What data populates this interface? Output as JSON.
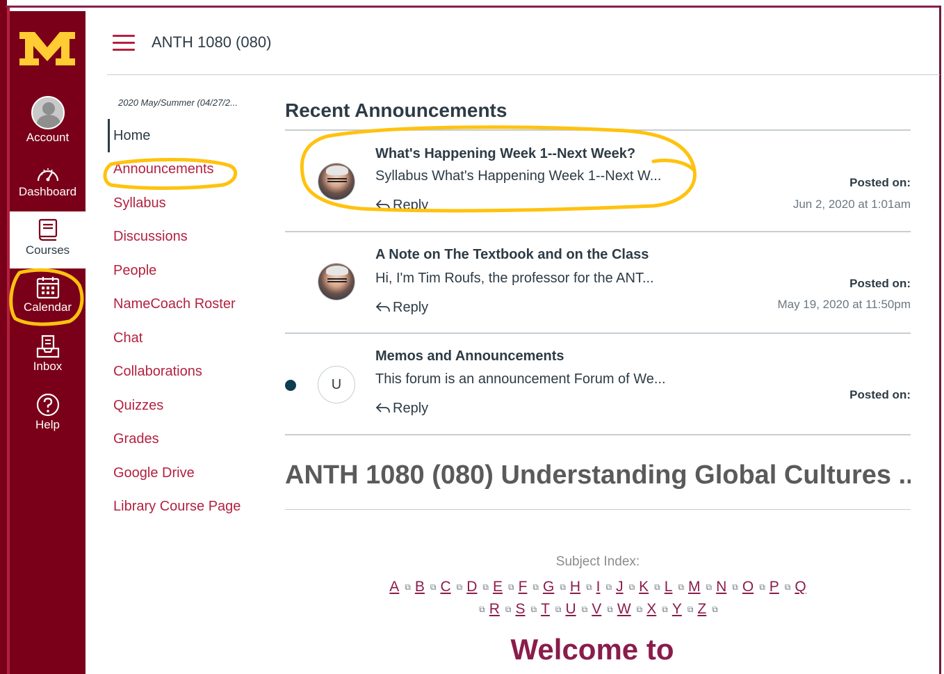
{
  "global_nav": {
    "items": [
      {
        "label": "Account",
        "icon": "account-avatar-icon"
      },
      {
        "label": "Dashboard",
        "icon": "dashboard-gauge-icon"
      },
      {
        "label": "Courses",
        "icon": "courses-book-icon"
      },
      {
        "label": "Calendar",
        "icon": "calendar-icon"
      },
      {
        "label": "Inbox",
        "icon": "inbox-icon"
      },
      {
        "label": "Help",
        "icon": "help-question-icon"
      }
    ],
    "active": "Courses",
    "colors": {
      "background": "#7a0019",
      "logo": "#ffcc33"
    }
  },
  "header": {
    "title": "ANTH 1080 (080)"
  },
  "course_nav": {
    "term": "2020 May/Summer (04/27/2...",
    "items": [
      "Home",
      "Announcements",
      "Syllabus",
      "Discussions",
      "People",
      "NameCoach Roster",
      "Chat",
      "Collaborations",
      "Quizzes",
      "Grades",
      "Google Drive",
      "Library Course Page"
    ],
    "active": "Home"
  },
  "announcements": {
    "section_title": "Recent Announcements",
    "items": [
      {
        "title": "What's Happening Week 1--Next Week?",
        "snippet": "Syllabus What's Happening Week 1--Next W...",
        "reply": "Reply",
        "posted_label": "Posted on:",
        "posted_date": "Jun 2, 2020 at 1:01am"
      },
      {
        "title": "A Note on The Textbook and on the Class",
        "snippet": "Hi,   I'm Tim Roufs, the professor for the ANT...",
        "reply": "Reply",
        "posted_label": "Posted on:",
        "posted_date": "May 19, 2020 at 11:50pm"
      },
      {
        "title": "Memos and Announcements",
        "snippet": "This forum is an announcement Forum of We...",
        "reply": "Reply",
        "posted_label": "Posted on:",
        "posted_date": "",
        "avatar_letter": "U",
        "unread": true
      }
    ]
  },
  "course_heading": "ANTH 1080 (080) Understanding Global Cultures ...",
  "subject_index": {
    "label": "Subject Index:",
    "letters": [
      "A",
      "B",
      "C",
      "D",
      "E",
      "F",
      "G",
      "H",
      "I",
      "J",
      "K",
      "L",
      "M",
      "N",
      "O",
      "P",
      "Q",
      "R",
      "S",
      "T",
      "U",
      "V",
      "W",
      "X",
      "Y",
      "Z"
    ]
  },
  "welcome": "Welcome to",
  "annotation_color": "#ffc20e"
}
